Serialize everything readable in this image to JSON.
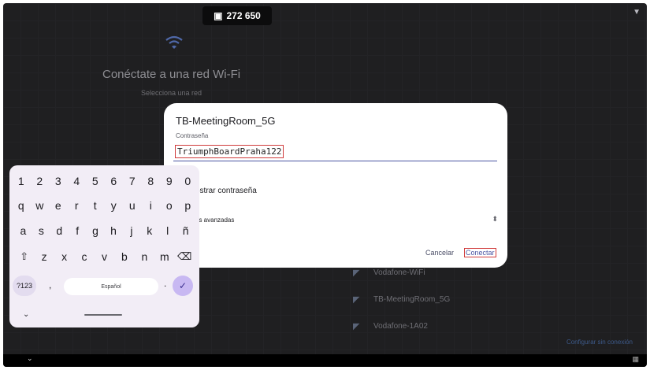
{
  "status": {
    "counter_text": "272 650",
    "counter_icon": "phone-icon",
    "wifi_status_icon": "wifi-status-icon"
  },
  "background": {
    "title": "Conéctate a una red Wi-Fi",
    "subtitle": "Selecciona una red",
    "networks": [
      {
        "name": "Vodafone-WiFi",
        "icon": "wifi-lock-icon"
      },
      {
        "name": "TB-MeetingRoom_5G",
        "icon": "wifi-lock-icon"
      },
      {
        "name": "Vodafone-1A02",
        "icon": "wifi-lock-icon"
      }
    ],
    "offline_link": "Configurar sin conexión"
  },
  "dialog": {
    "title": "TB-MeetingRoom_5G",
    "password_label": "Contraseña",
    "password_value": "TriumphBoardPraha122",
    "show_password_label": "ostrar contraseña",
    "advanced_label": "es avanzadas",
    "cancel_label": "Cancelar",
    "connect_label": "Conectar"
  },
  "keyboard": {
    "row1": [
      "1",
      "2",
      "3",
      "4",
      "5",
      "6",
      "7",
      "8",
      "9",
      "0"
    ],
    "row2": [
      "q",
      "w",
      "e",
      "r",
      "t",
      "y",
      "u",
      "i",
      "o",
      "p"
    ],
    "row3": [
      "a",
      "s",
      "d",
      "f",
      "g",
      "h",
      "j",
      "k",
      "l",
      "ñ"
    ],
    "row4": [
      "⇧",
      "z",
      "x",
      "c",
      "v",
      "b",
      "n",
      "m",
      "⌫"
    ],
    "symbols_key": "?123",
    "comma_key": ",",
    "space_label": "Español",
    "period_key": ".",
    "enter_icon": "check-icon",
    "collapse_icon": "chevron-down-icon"
  },
  "navbar": {
    "back_icon": "chevron-down-icon",
    "keyboard_icon": "keyboard-icon"
  }
}
